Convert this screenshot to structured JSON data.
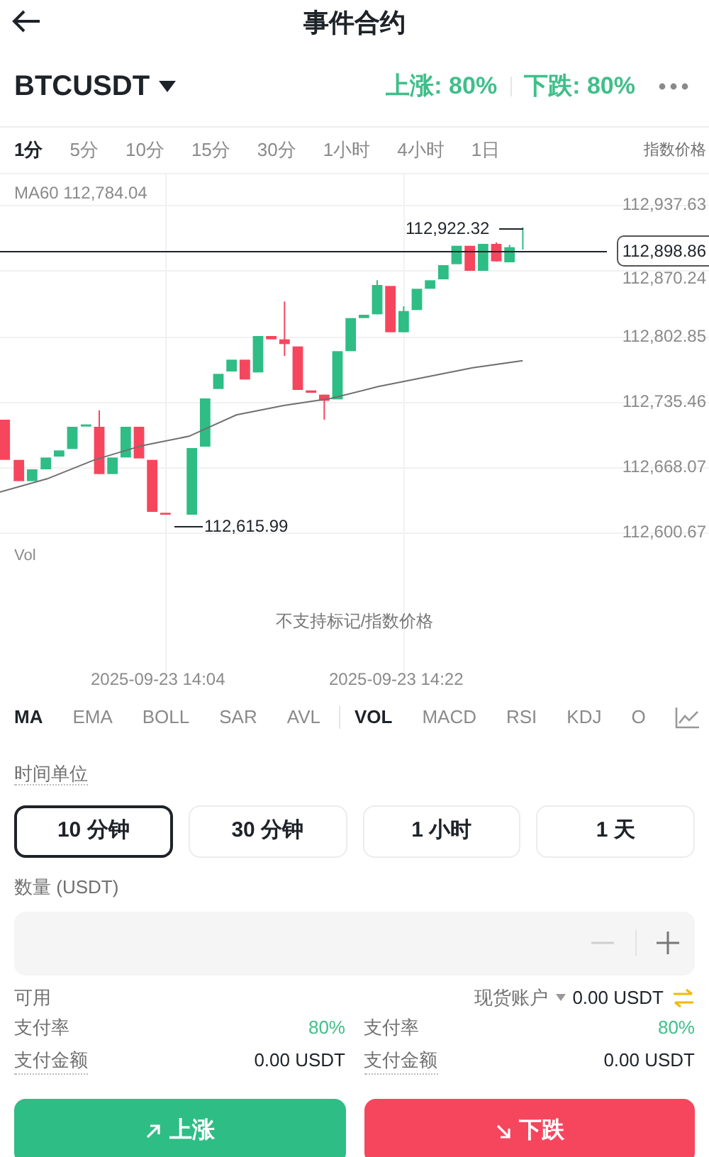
{
  "header": {
    "title": "事件合约"
  },
  "market": {
    "symbol": "BTCUSDT",
    "up": "上涨: 80%",
    "down": "下跌: 80%"
  },
  "intervals": [
    {
      "label": "1分",
      "selected": true
    },
    {
      "label": "5分",
      "selected": false
    },
    {
      "label": "10分",
      "selected": false
    },
    {
      "label": "15分",
      "selected": false
    },
    {
      "label": "30分",
      "selected": false
    },
    {
      "label": "1小时",
      "selected": false
    },
    {
      "label": "4小时",
      "selected": false
    },
    {
      "label": "1日",
      "selected": false
    }
  ],
  "price_source": "指数价格",
  "chart": {
    "ma_label": "MA60 112,784.04",
    "price_axis": [
      "112,937.63",
      "112,870.24",
      "112,802.85",
      "112,735.46",
      "112,668.07",
      "112,600.67"
    ],
    "current_price": "112,898.86",
    "high_label": "112,922.32",
    "low_label": "112,615.99",
    "vol_label": "Vol",
    "notice": "不支持标记/指数价格",
    "time_labels": [
      "2025-09-23 14:04",
      "2025-09-23 14:22"
    ]
  },
  "main_indicators": [
    {
      "label": "MA",
      "selected": true
    },
    {
      "label": "EMA",
      "selected": false
    },
    {
      "label": "BOLL",
      "selected": false
    },
    {
      "label": "SAR",
      "selected": false
    },
    {
      "label": "AVL",
      "selected": false
    }
  ],
  "sub_indicators": [
    {
      "label": "VOL",
      "selected": true
    },
    {
      "label": "MACD",
      "selected": false
    },
    {
      "label": "RSI",
      "selected": false
    },
    {
      "label": "KDJ",
      "selected": false
    },
    {
      "label": "O",
      "selected": false
    }
  ],
  "time_unit": {
    "label": "时间单位",
    "options": [
      {
        "label": "10 分钟",
        "selected": true
      },
      {
        "label": "30 分钟",
        "selected": false
      },
      {
        "label": "1 小时",
        "selected": false
      },
      {
        "label": "1 天",
        "selected": false
      }
    ]
  },
  "quantity": {
    "label": "数量 (USDT)"
  },
  "available": {
    "label": "可用",
    "account": "现货账户",
    "amount": "0.00 USDT"
  },
  "payouts": [
    {
      "rate_label": "支付率",
      "rate": "80%",
      "amount_label": "支付金额",
      "amount": "0.00 USDT"
    },
    {
      "rate_label": "支付率",
      "rate": "80%",
      "amount_label": "支付金额",
      "amount": "0.00 USDT"
    }
  ],
  "actions": [
    {
      "label": "上涨",
      "kind": "up"
    },
    {
      "label": "下跌",
      "kind": "down"
    }
  ]
}
